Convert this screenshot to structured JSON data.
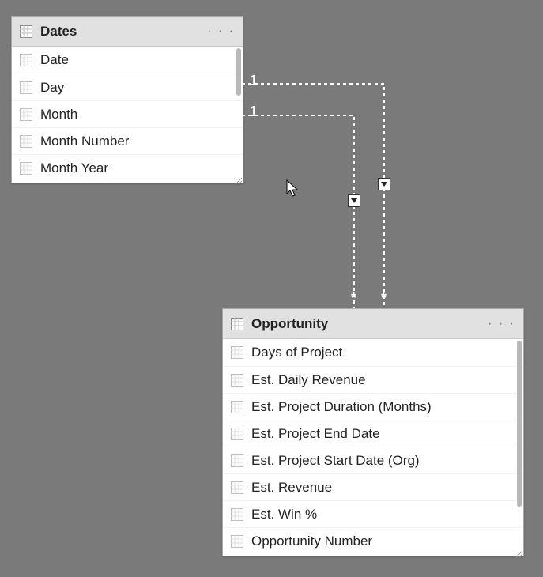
{
  "tables": {
    "dates": {
      "title": "Dates",
      "more": "· · ·",
      "fields": [
        "Date",
        "Day",
        "Month",
        "Month Number",
        "Month Year"
      ]
    },
    "opportunity": {
      "title": "Opportunity",
      "more": "· · ·",
      "fields": [
        "Days of Project",
        "Est. Daily Revenue",
        "Est. Project Duration (Months)",
        "Est. Project End Date",
        "Est. Project Start Date (Org)",
        "Est. Revenue",
        "Est. Win %",
        "Opportunity Number"
      ]
    }
  },
  "relationships": {
    "one_label_a": "1",
    "one_label_b": "1",
    "many_label_a": "*",
    "many_label_b": "*"
  }
}
